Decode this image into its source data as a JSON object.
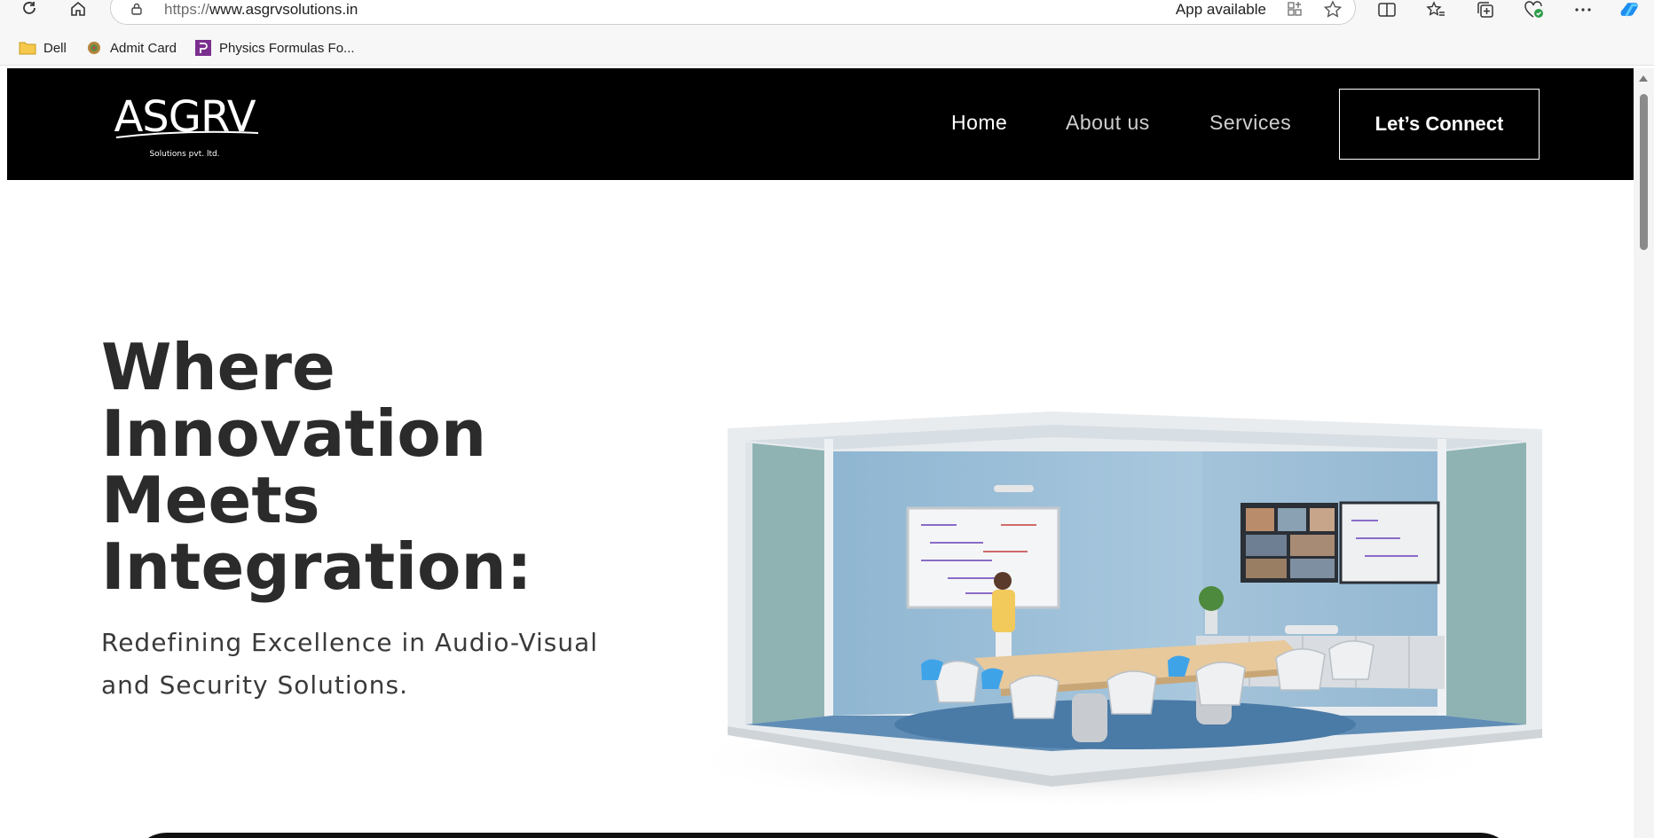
{
  "browser": {
    "url_protocol": "https://",
    "url_host": "www.asgrvsolutions.in",
    "app_available": "App available",
    "icons": [
      "refresh-icon",
      "home-icon",
      "lock-icon",
      "app-install-icon",
      "favorite-star-icon",
      "split-screen-icon",
      "favorites-icon",
      "collections-icon",
      "performance-icon",
      "more-icon",
      "copilot-icon"
    ]
  },
  "bookmarks": [
    {
      "label": "Dell",
      "icon": "folder-icon"
    },
    {
      "label": "Admit Card",
      "icon": "site-icon"
    },
    {
      "label": "Physics Formulas Fo...",
      "icon": "site-icon"
    }
  ],
  "site": {
    "logo_text": "ASGRV",
    "logo_subtext": "Solutions pvt. ltd.",
    "nav": {
      "home": "Home",
      "about": "About us",
      "services": "Services",
      "connect": "Let’s Connect"
    },
    "hero": {
      "title_lines": [
        "Where",
        "Innovation",
        "Meets",
        "Integration:"
      ],
      "subtitle_lines": [
        "Redefining Excellence in Audio-Visual",
        "and Security Solutions."
      ]
    }
  },
  "colors": {
    "header_bg": "#000000",
    "text_dark": "#2b2b2b",
    "wall_blue": "#9fc2dc"
  }
}
